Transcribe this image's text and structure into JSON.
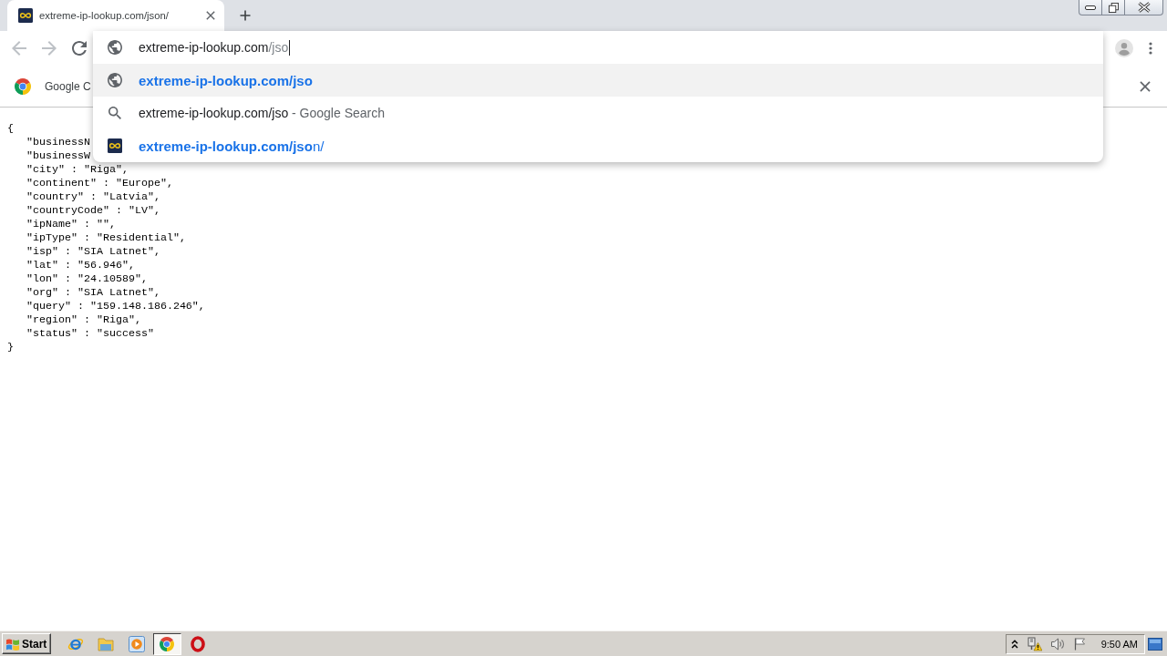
{
  "tabs": [
    {
      "title": "extreme-ip-lookup.com/json/",
      "selected": true
    }
  ],
  "toolbar": {
    "back": {
      "disabled": true
    },
    "forward": {
      "disabled": true
    }
  },
  "omnibox": {
    "host": "extreme-ip-lookup.com",
    "path": "/jso"
  },
  "suggestions": [
    {
      "kind": "url",
      "text": "extreme-ip-lookup.com/jso",
      "selected": true
    },
    {
      "kind": "search",
      "text": "extreme-ip-lookup.com/jso",
      "description": "- Google Search",
      "selected": false
    },
    {
      "kind": "site",
      "text": "**extreme-ip-lookup.com/jso**n/",
      "selected": false
    }
  ],
  "infobar": {
    "message": "Google C"
  },
  "page": {
    "open": "{",
    "entries": [
      "\"businessN",
      "\"businessW",
      "\"city\" : \"Riga\",",
      "\"continent\" : \"Europe\",",
      "\"country\" : \"Latvia\",",
      "\"countryCode\" : \"LV\",",
      "\"ipName\" : \"\",",
      "\"ipType\" : \"Residential\",",
      "\"isp\" : \"SIA Latnet\",",
      "\"lat\" : \"56.946\",",
      "\"lon\" : \"24.10589\",",
      "\"org\" : \"SIA Latnet\",",
      "\"query\" : \"159.148.186.246\",",
      "\"region\" : \"Riga\",",
      "\"status\" : \"success\""
    ],
    "close": "}"
  },
  "taskbar": {
    "start": "Start",
    "apps": [
      {
        "kind": "ie",
        "active": false
      },
      {
        "kind": "folder",
        "active": false
      },
      {
        "kind": "media",
        "active": false
      },
      {
        "kind": "chrome",
        "active": true
      },
      {
        "kind": "opera",
        "active": false
      }
    ],
    "clock": "9:50 AM"
  }
}
